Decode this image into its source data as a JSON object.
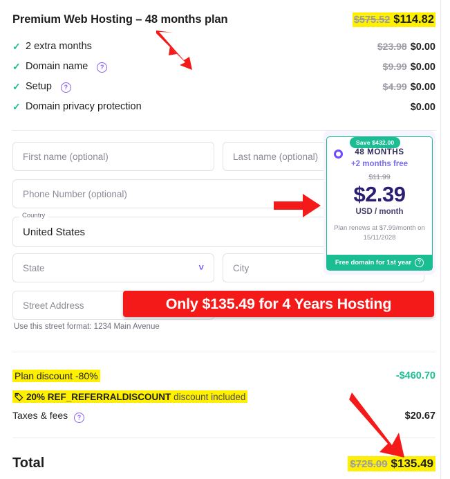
{
  "header": {
    "title": "Premium Web Hosting – 48 months plan",
    "original_price": "$575.52",
    "current_price": "$114.82"
  },
  "features": [
    {
      "label": "2 extra months",
      "has_help": false,
      "original_price": "$23.98",
      "price": "$0.00"
    },
    {
      "label": "Domain name",
      "has_help": true,
      "original_price": "$9.99",
      "price": "$0.00"
    },
    {
      "label": "Setup",
      "has_help": true,
      "original_price": "$4.99",
      "price": "$0.00"
    },
    {
      "label": "Domain privacy protection",
      "has_help": false,
      "original_price": "",
      "price": "$0.00"
    }
  ],
  "form": {
    "first_name_placeholder": "First name (optional)",
    "last_name_placeholder": "Last name (optional)",
    "phone_placeholder": "Phone Number (optional)",
    "country_label": "Country",
    "country_value": "United States",
    "state_placeholder": "State",
    "city_placeholder": "City",
    "street_placeholder": "Street Address",
    "street_hint": "Use this street format: 1234 Main Avenue"
  },
  "plan_card": {
    "save_badge": "Save $432.00",
    "duration": "48 MONTHS",
    "bonus": "+2 months free",
    "old_price": "$11.99",
    "price": "$2.39",
    "period": "USD / month",
    "renewal": "Plan renews at $7.99/month on 15/11/2028",
    "footer": "Free domain for 1st year"
  },
  "summary": {
    "plan_discount_label": "Plan discount -80%",
    "plan_discount_value": "-$460.70",
    "promo_percent": "20%",
    "promo_code": "REF_REFERRALDISCOUNT",
    "promo_suffix": "discount included",
    "taxes_label": "Taxes & fees",
    "taxes_value": "$20.67",
    "total_label": "Total",
    "total_original": "$725.09",
    "total_value": "$135.49"
  },
  "annotations": {
    "banner_text": "Only $135.49 for 4 Years Hosting"
  },
  "colors": {
    "accent_green": "#1bbd92",
    "accent_purple": "#6d4aff",
    "highlight_yellow": "#fff000",
    "annotation_red": "#f51a1a",
    "price_dark": "#2a1e72"
  }
}
